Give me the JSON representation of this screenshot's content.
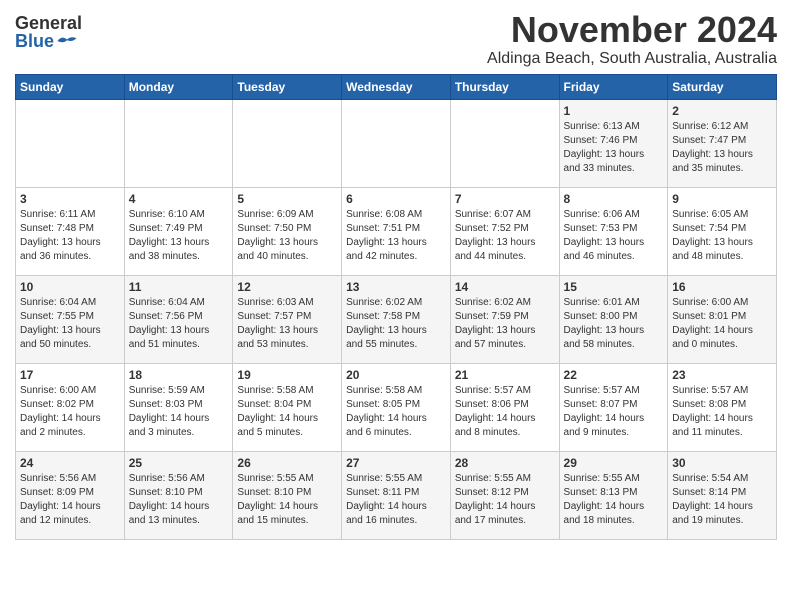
{
  "header": {
    "logo_general": "General",
    "logo_blue": "Blue",
    "month": "November 2024",
    "location": "Aldinga Beach, South Australia, Australia"
  },
  "days_of_week": [
    "Sunday",
    "Monday",
    "Tuesday",
    "Wednesday",
    "Thursday",
    "Friday",
    "Saturday"
  ],
  "weeks": [
    {
      "days": [
        {
          "num": "",
          "info": ""
        },
        {
          "num": "",
          "info": ""
        },
        {
          "num": "",
          "info": ""
        },
        {
          "num": "",
          "info": ""
        },
        {
          "num": "",
          "info": ""
        },
        {
          "num": "1",
          "info": "Sunrise: 6:13 AM\nSunset: 7:46 PM\nDaylight: 13 hours\nand 33 minutes."
        },
        {
          "num": "2",
          "info": "Sunrise: 6:12 AM\nSunset: 7:47 PM\nDaylight: 13 hours\nand 35 minutes."
        }
      ]
    },
    {
      "days": [
        {
          "num": "3",
          "info": "Sunrise: 6:11 AM\nSunset: 7:48 PM\nDaylight: 13 hours\nand 36 minutes."
        },
        {
          "num": "4",
          "info": "Sunrise: 6:10 AM\nSunset: 7:49 PM\nDaylight: 13 hours\nand 38 minutes."
        },
        {
          "num": "5",
          "info": "Sunrise: 6:09 AM\nSunset: 7:50 PM\nDaylight: 13 hours\nand 40 minutes."
        },
        {
          "num": "6",
          "info": "Sunrise: 6:08 AM\nSunset: 7:51 PM\nDaylight: 13 hours\nand 42 minutes."
        },
        {
          "num": "7",
          "info": "Sunrise: 6:07 AM\nSunset: 7:52 PM\nDaylight: 13 hours\nand 44 minutes."
        },
        {
          "num": "8",
          "info": "Sunrise: 6:06 AM\nSunset: 7:53 PM\nDaylight: 13 hours\nand 46 minutes."
        },
        {
          "num": "9",
          "info": "Sunrise: 6:05 AM\nSunset: 7:54 PM\nDaylight: 13 hours\nand 48 minutes."
        }
      ]
    },
    {
      "days": [
        {
          "num": "10",
          "info": "Sunrise: 6:04 AM\nSunset: 7:55 PM\nDaylight: 13 hours\nand 50 minutes."
        },
        {
          "num": "11",
          "info": "Sunrise: 6:04 AM\nSunset: 7:56 PM\nDaylight: 13 hours\nand 51 minutes."
        },
        {
          "num": "12",
          "info": "Sunrise: 6:03 AM\nSunset: 7:57 PM\nDaylight: 13 hours\nand 53 minutes."
        },
        {
          "num": "13",
          "info": "Sunrise: 6:02 AM\nSunset: 7:58 PM\nDaylight: 13 hours\nand 55 minutes."
        },
        {
          "num": "14",
          "info": "Sunrise: 6:02 AM\nSunset: 7:59 PM\nDaylight: 13 hours\nand 57 minutes."
        },
        {
          "num": "15",
          "info": "Sunrise: 6:01 AM\nSunset: 8:00 PM\nDaylight: 13 hours\nand 58 minutes."
        },
        {
          "num": "16",
          "info": "Sunrise: 6:00 AM\nSunset: 8:01 PM\nDaylight: 14 hours\nand 0 minutes."
        }
      ]
    },
    {
      "days": [
        {
          "num": "17",
          "info": "Sunrise: 6:00 AM\nSunset: 8:02 PM\nDaylight: 14 hours\nand 2 minutes."
        },
        {
          "num": "18",
          "info": "Sunrise: 5:59 AM\nSunset: 8:03 PM\nDaylight: 14 hours\nand 3 minutes."
        },
        {
          "num": "19",
          "info": "Sunrise: 5:58 AM\nSunset: 8:04 PM\nDaylight: 14 hours\nand 5 minutes."
        },
        {
          "num": "20",
          "info": "Sunrise: 5:58 AM\nSunset: 8:05 PM\nDaylight: 14 hours\nand 6 minutes."
        },
        {
          "num": "21",
          "info": "Sunrise: 5:57 AM\nSunset: 8:06 PM\nDaylight: 14 hours\nand 8 minutes."
        },
        {
          "num": "22",
          "info": "Sunrise: 5:57 AM\nSunset: 8:07 PM\nDaylight: 14 hours\nand 9 minutes."
        },
        {
          "num": "23",
          "info": "Sunrise: 5:57 AM\nSunset: 8:08 PM\nDaylight: 14 hours\nand 11 minutes."
        }
      ]
    },
    {
      "days": [
        {
          "num": "24",
          "info": "Sunrise: 5:56 AM\nSunset: 8:09 PM\nDaylight: 14 hours\nand 12 minutes."
        },
        {
          "num": "25",
          "info": "Sunrise: 5:56 AM\nSunset: 8:10 PM\nDaylight: 14 hours\nand 13 minutes."
        },
        {
          "num": "26",
          "info": "Sunrise: 5:55 AM\nSunset: 8:10 PM\nDaylight: 14 hours\nand 15 minutes."
        },
        {
          "num": "27",
          "info": "Sunrise: 5:55 AM\nSunset: 8:11 PM\nDaylight: 14 hours\nand 16 minutes."
        },
        {
          "num": "28",
          "info": "Sunrise: 5:55 AM\nSunset: 8:12 PM\nDaylight: 14 hours\nand 17 minutes."
        },
        {
          "num": "29",
          "info": "Sunrise: 5:55 AM\nSunset: 8:13 PM\nDaylight: 14 hours\nand 18 minutes."
        },
        {
          "num": "30",
          "info": "Sunrise: 5:54 AM\nSunset: 8:14 PM\nDaylight: 14 hours\nand 19 minutes."
        }
      ]
    }
  ]
}
